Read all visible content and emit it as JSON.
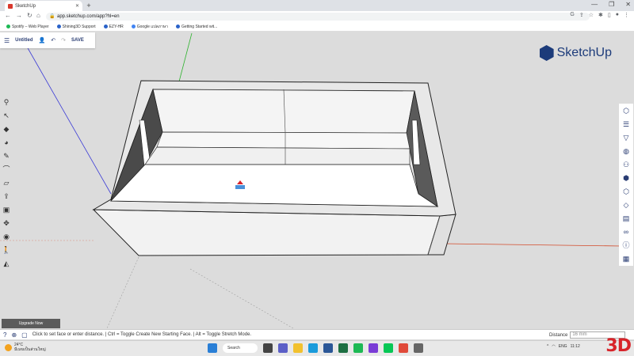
{
  "browser": {
    "tab_title": "SketchUp",
    "url": "app.sketchup.com/app?hl=en",
    "bookmarks": [
      "Spotify – Web Player",
      "Shining3D Support",
      "EZY-HR",
      "Google แปลภาษา",
      "Getting Started wit..."
    ]
  },
  "app": {
    "title": "Untitled",
    "save_label": "SAVE",
    "logo_text": "SketchUp",
    "upgrade_label": "Upgrade Now",
    "status_text": "Click to set face or enter distance. | Ctrl = Toggle Create New Starting Face. | Alt = Toggle Stretch Mode.",
    "distance_label": "Distance",
    "distance_value": "16 mm",
    "left_tools": [
      "select-icon",
      "eraser-icon",
      "paint-bucket-icon",
      "pencil-icon",
      "arc-icon",
      "rectangle-icon",
      "push-pull-icon",
      "offset-icon",
      "move-icon",
      "tape-measure-icon",
      "walk-icon",
      "section-plane-icon"
    ],
    "right_tools": [
      "entity-info-icon",
      "layers-icon",
      "styles-icon",
      "materials-icon",
      "components-icon",
      "outliner-icon",
      "scenes-icon",
      "tags-icon",
      "display-icon",
      "glasses-icon",
      "info-icon",
      "instructor-icon"
    ]
  },
  "taskbar": {
    "weather_temp": "24°C",
    "weather_desc": "มีเมฆเป็นส่วนใหญ่",
    "search_label": "Search",
    "language": "ENG",
    "time": "11:12"
  },
  "watermark": "3D"
}
